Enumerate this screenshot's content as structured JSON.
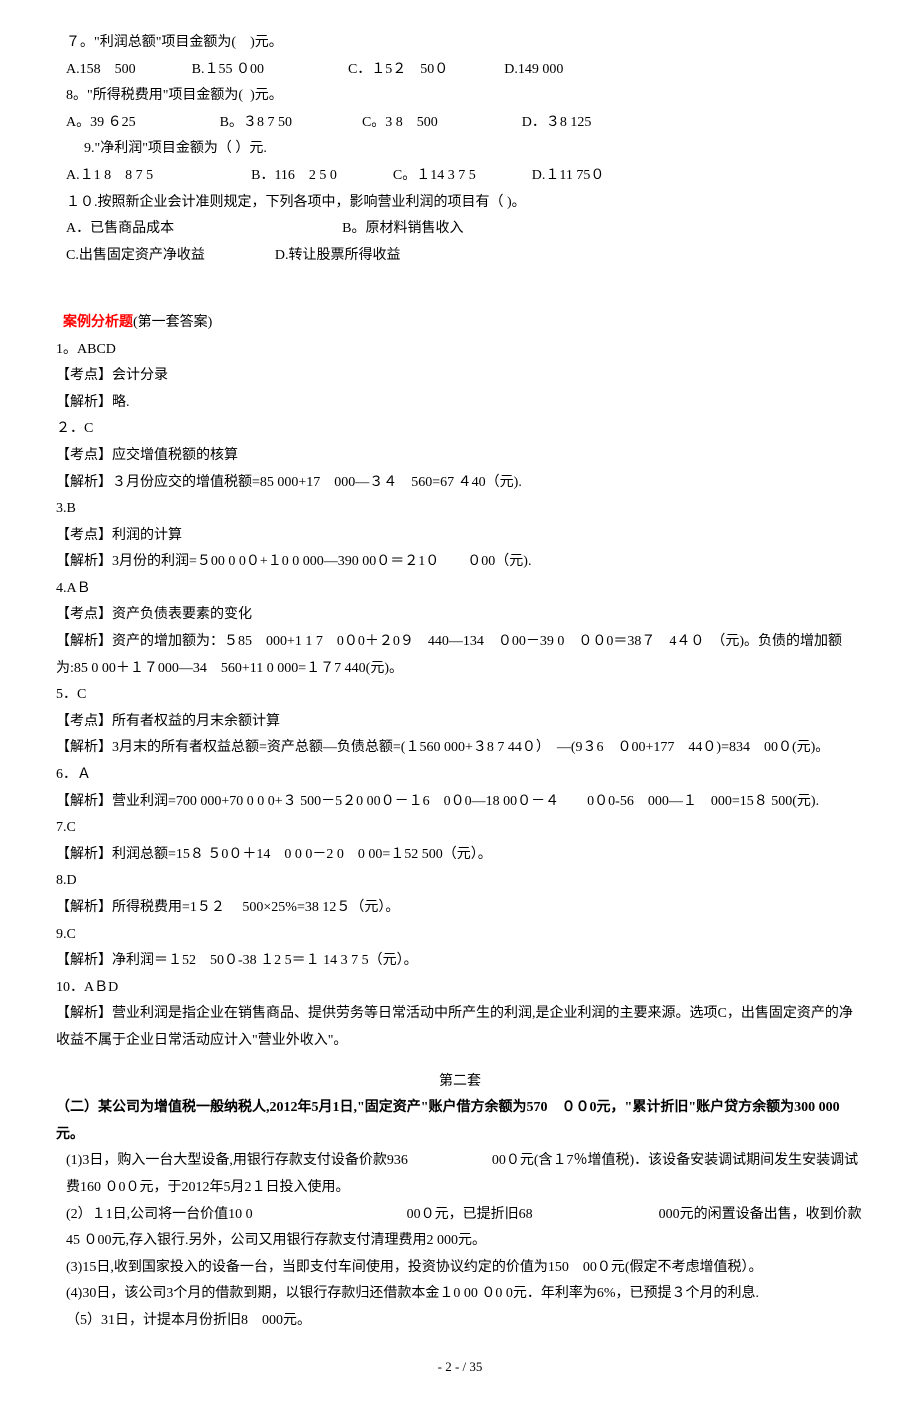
{
  "q7": {
    "text": "７。\"利润总额\"项目金额为(　)元。",
    "opts": "A.158　500　　　　B.１55 ０00　　　　　　C．１5２　50０　　　　D.149 000"
  },
  "q8": {
    "text": "8。\"所得税费用\"项目金额为(  )元。",
    "opts": "A。39 ６25　　　　　　B。３8 7 50　　　　　C。3 8　500　　　　　　D．３8 125"
  },
  "q9": {
    "text": "9.\"净利润\"项目金额为（ ）元.",
    "opts": "A.１1 8　8 7 5　　　　　　　B．116　2 5 0　　　　C。１14 3 7 5　　　　D.１11 75０"
  },
  "q10": {
    "text": "１０.按照新企业会计准则规定，下列各项中，影响营业利润的项目有（ )。",
    "optsA": "A．已售商品成本　　　　　　　　　　　　B。原材料销售收入",
    "optsB": "C.出售固定资产净收益　　　　　D.转让股票所得收益"
  },
  "ans_header": "案例分析题",
  "ans_header_suffix": "(第一套答案)",
  "a1": {
    "num": "1。ABCD",
    "point": "【考点】会计分录",
    "exp": "【解析】略."
  },
  "a2": {
    "num": "２．C",
    "point": "【考点】应交增值税额的核算",
    "exp": "【解析】３月份应交的增值税额=85 000+17　000―３４　560=67 ４40（元)."
  },
  "a3": {
    "num": "3.B",
    "point": "【考点】利润的计算",
    "exp": "【解析】3月份的利润=５00 0 0０+１0 0 000—390 00０＝２1０　　０00（元)."
  },
  "a4": {
    "num": "4.AＢ",
    "point": "【考点】资产负债表要素的变化",
    "exp": "【解析】资产的增加额为：５85　000+1 1 7　0０0＋２0９　440—134　０00－39 0　００0＝38７　4４０　（元)。负债的增加额为:85 0 00＋１７000—34　560+11 0 000=１７7 440(元)。"
  },
  "a5": {
    "num": "5．C",
    "point": "【考点】所有者权益的月末余额计算",
    "exp": "【解析】3月末的所有者权益总额=资产总额—负债总额=(１560 000+３8 7 44０）　―(9３6　０00+177　44０)=834　00０(元)。"
  },
  "a6": {
    "num": "6．Ａ",
    "exp": "【解析】营业利润=700 000+70 0 0 0+３ 500－5２0 00０－１6　0０0—18 00０－４　　0０0-56　000—１　000=15８ 500(元)."
  },
  "a7": {
    "num": "7.C",
    "exp": "【解析】利润总额=15８ ５0０＋14　0 0 0－2 0　0 00=１52 500（元）。"
  },
  "a8": {
    "num": "8.D",
    "exp": "【解析】所得税费用=1５２　 500×25%=38 12５（元）。"
  },
  "a9": {
    "num": "9.C",
    "exp": "【解析】净利润＝１52　50０-38 １2 5＝１ 14 3 7 5（元）。"
  },
  "a10": {
    "num": "10．AＢD",
    "exp": "【解析】营业利润是指企业在销售商品、提供劳务等日常活动中所产生的利润,是企业利润的主要来源。选项C，出售固定资产的净收益不属于企业日常活动应计入\"营业外收入\"。"
  },
  "set2_title": "第二套",
  "set2_intro": "（二）某公司为增值税一般纳税人,2012年5月1日,\"固定资产\"账户借方余额为570　００0元，\"累计折旧\"账户贷方余额为300 000元。",
  "set2_item1": "(1)3日，购入一台大型设备,用银行存款支付设备价款936　　　　　　00０元(含１7％增值税)．该设备安装调试期间发生安装调试费160 ０0０元，于2012年5月2１日投入使用。",
  "set2_item2": "(2）１1日,公司将一台价值10 0　　　　　　　　　　　00０元，已提折旧68　　　　　　　　　000元的闲置设备出售，收到价款45 ０00元,存入银行.另外，公司又用银行存款支付清理费用2 000元。",
  "set2_item3": "(3)15日,收到国家投入的设备一台，当即支付车间使用，投资协议约定的价值为150　00０元(假定不考虑增值税）。",
  "set2_item4": "(4)30日，该公司3个月的借款到期，以银行存款归还借款本金１0 00 ０0 0元．年利率为6%，已预提３个月的利息.",
  "set2_item5": "（5）31日，计提本月份折旧8　000元。",
  "footer": "- 2 - / 35"
}
